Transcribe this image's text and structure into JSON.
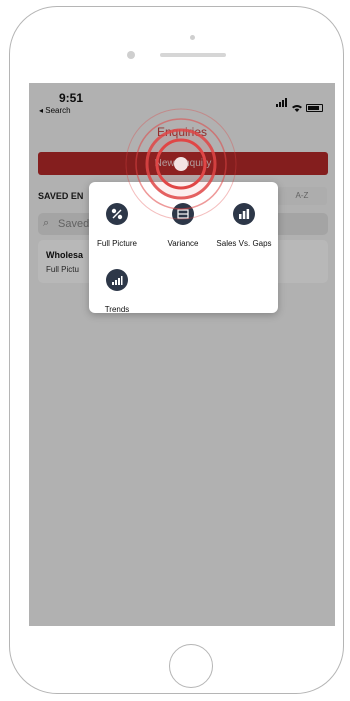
{
  "status": {
    "time": "9:51",
    "back": "◂ Search"
  },
  "header": {
    "title": "Enquiries",
    "new_button": "New Enquiry"
  },
  "saved": {
    "label": "SAVED EN",
    "sort": "A-Z",
    "search_placeholder": "Saved",
    "item_title": "Wholesa",
    "item_subtitle": "Full Pictu"
  },
  "menu": {
    "options": [
      {
        "label": "Full Picture",
        "icon": "chart-pie-icon"
      },
      {
        "label": "Variance",
        "icon": "variance-icon"
      },
      {
        "label": "Sales Vs. Gaps",
        "icon": "bar-grid-icon"
      },
      {
        "label": "Trends",
        "icon": "trend-bars-icon"
      }
    ]
  },
  "colors": {
    "accent": "#b72a2a",
    "icon_bg": "#2d3748",
    "touch": "#e04646"
  }
}
